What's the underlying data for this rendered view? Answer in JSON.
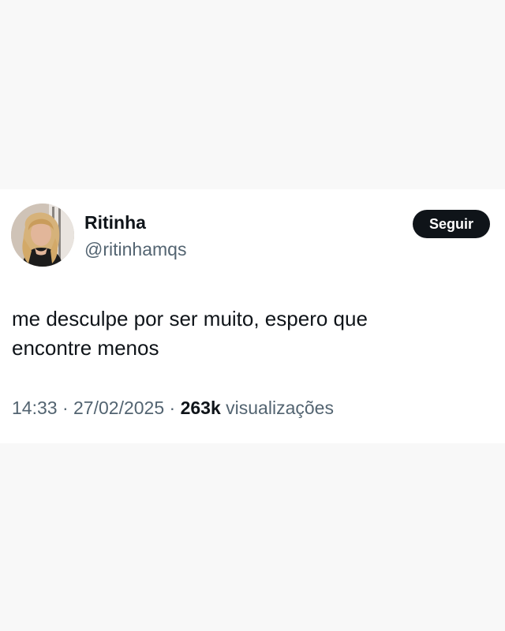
{
  "tweet": {
    "author": {
      "display_name": "Ritinha",
      "handle": "@ritinhamqs",
      "avatar_icon": "profile-photo"
    },
    "follow_label": "Seguir",
    "text_lines": [
      "me desculpe por ser muito, espero que",
      "encontre menos"
    ],
    "time": "14:33",
    "separator": " · ",
    "date": "27/02/2025",
    "views_count": "263k",
    "views_label": " visualizações"
  },
  "colors": {
    "background": "#f8f8f8",
    "card": "#ffffff",
    "primary_text": "#0f1419",
    "secondary_text": "#536471",
    "button_bg": "#0f1419",
    "button_text": "#ffffff"
  }
}
